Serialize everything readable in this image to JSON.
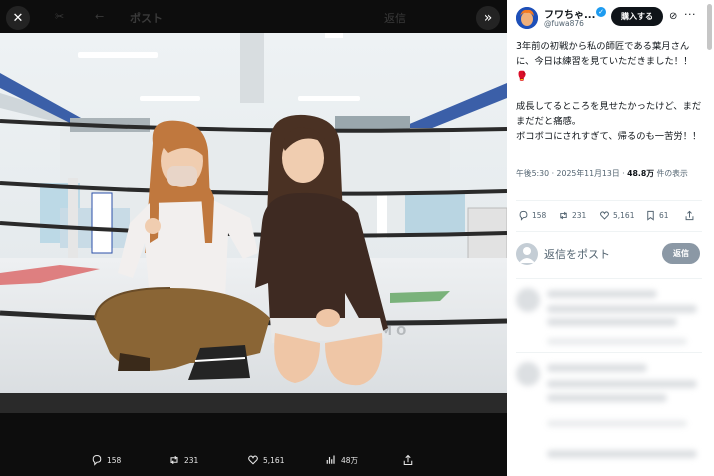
{
  "viewer": {
    "top_title": "ポスト",
    "top_faded": "返信",
    "close_icon": "close-icon",
    "expand_icon": "double-chevron-right-icon",
    "bottom_actions": [
      {
        "icon": "reply-icon",
        "count": "158"
      },
      {
        "icon": "repost-icon",
        "count": "231"
      },
      {
        "icon": "like-icon",
        "count": "5,161"
      },
      {
        "icon": "views-icon",
        "count": "48万"
      },
      {
        "icon": "share-icon",
        "count": ""
      }
    ]
  },
  "post": {
    "display_name": "フワちゃ...",
    "handle": "@fuwa876",
    "subscribe_label": "購入する",
    "text": "3年前の初戦から私の師匠である葉月さんに、今日は練習を見ていただきました！！🥊\n\n成長してるところを見せたかったけど、まだまだだと痛感。\nボコボコにされすぎて、帰るのも一苦労！！",
    "meta_time": "午後5:30 · 2025年11月13日 · ",
    "meta_views": "48.8万",
    "meta_views_suffix": " 件の表示",
    "actions": [
      {
        "icon": "reply-icon",
        "count": "158"
      },
      {
        "icon": "repost-icon",
        "count": "231"
      },
      {
        "icon": "like-icon",
        "count": "5,161"
      },
      {
        "icon": "bookmark-icon",
        "count": "61"
      },
      {
        "icon": "share-icon",
        "count": ""
      }
    ]
  },
  "reply_box": {
    "placeholder": "返信をポスト",
    "button_label": "返信"
  },
  "colors": {
    "accent": "#1d9bf0",
    "text": "#0f1419",
    "muted": "#536471"
  }
}
